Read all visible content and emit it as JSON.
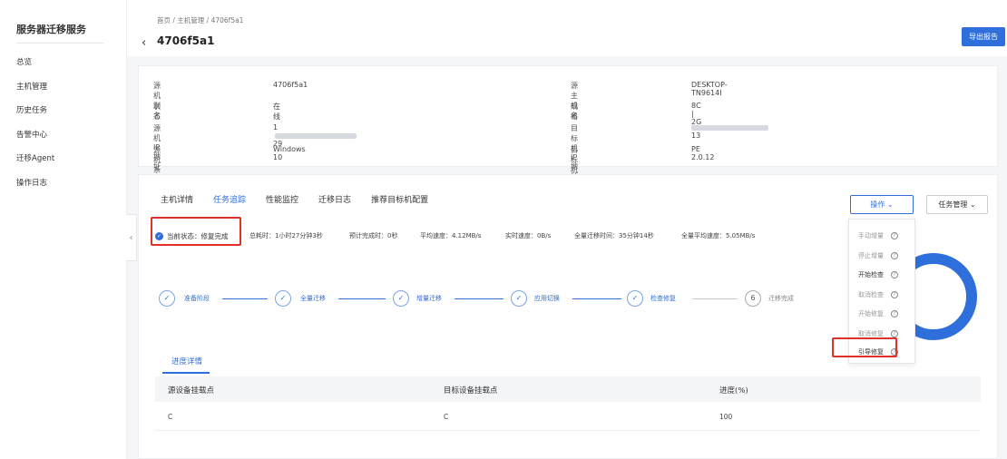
{
  "sidebar": {
    "app_title": "服务器迁移服务",
    "items": [
      {
        "label": "总览"
      },
      {
        "label": "主机管理"
      },
      {
        "label": "历史任务"
      },
      {
        "label": "告警中心"
      },
      {
        "label": "迁移Agent"
      },
      {
        "label": "操作日志"
      }
    ],
    "collapse_glyph": "‹"
  },
  "header": {
    "breadcrumb": "首页 / 主机管理 / 4706f5a1",
    "back_glyph": "‹",
    "title": "4706f5a1",
    "export_label": "导出报告"
  },
  "info": {
    "source_alias_label": "源机别名",
    "source_alias": "4706f5a1",
    "status_label": "状态",
    "status": "在线",
    "source_ip_label": "源机IP地址",
    "source_ip_prefix": "1",
    "source_ip_suffix": "29",
    "source_os_label": "源机系统版本",
    "source_os": "Windows 10",
    "source_host_label": "源主机名",
    "source_host": "DESKTOP-TN9614I",
    "spec_label": "规格",
    "spec": "8C | 2G",
    "target_ip_label": "目标机IP地址",
    "target_ip_suffix": "13",
    "target_os_label": "目标机系统版本",
    "target_os": "PE 2.0.12"
  },
  "tabs": [
    {
      "label": "主机详情"
    },
    {
      "label": "任务追踪"
    },
    {
      "label": "性能监控"
    },
    {
      "label": "迁移日志"
    },
    {
      "label": "推荐目标机配置"
    }
  ],
  "actions": {
    "ops_label": "操作 ⌄",
    "task_mgmt_label": "任务管理 ⌄"
  },
  "status_bar": {
    "check_glyph": "✓",
    "current_status": "当前状态：修复完成",
    "total_time": "总耗时：1小时27分钟3秒",
    "eta": "预计完成时：0秒",
    "avg_speed": "平均速度：4.12MB/s",
    "realtime_speed": "实时速度：0B/s",
    "full_time": "全量迁移时间：35分钟14秒",
    "full_avg_speed": "全量平均速度：5.05MB/s"
  },
  "steps": [
    {
      "glyph": "✓",
      "label": "准备阶段"
    },
    {
      "glyph": "✓",
      "label": "全量迁移"
    },
    {
      "glyph": "✓",
      "label": "增量迁移"
    },
    {
      "glyph": "✓",
      "label": "应用切换"
    },
    {
      "glyph": "✓",
      "label": "检查修复"
    },
    {
      "glyph": "6",
      "label": "迁移完成"
    }
  ],
  "dropdown": {
    "help_glyph": "?",
    "items": [
      {
        "label": "手动增量"
      },
      {
        "label": "停止增量"
      },
      {
        "label": "开始检查"
      },
      {
        "label": "取消检查"
      },
      {
        "label": "开始修复"
      },
      {
        "label": "取消修复"
      },
      {
        "label": "引导修复"
      }
    ]
  },
  "progress": {
    "subtab": "进度详情",
    "columns": [
      "源设备挂载点",
      "目标设备挂载点",
      "进度(%)"
    ],
    "rows": [
      [
        "C",
        "C",
        "100"
      ]
    ]
  },
  "colors": {
    "accent": "#2f6fdb",
    "highlight": "#e0322b"
  }
}
